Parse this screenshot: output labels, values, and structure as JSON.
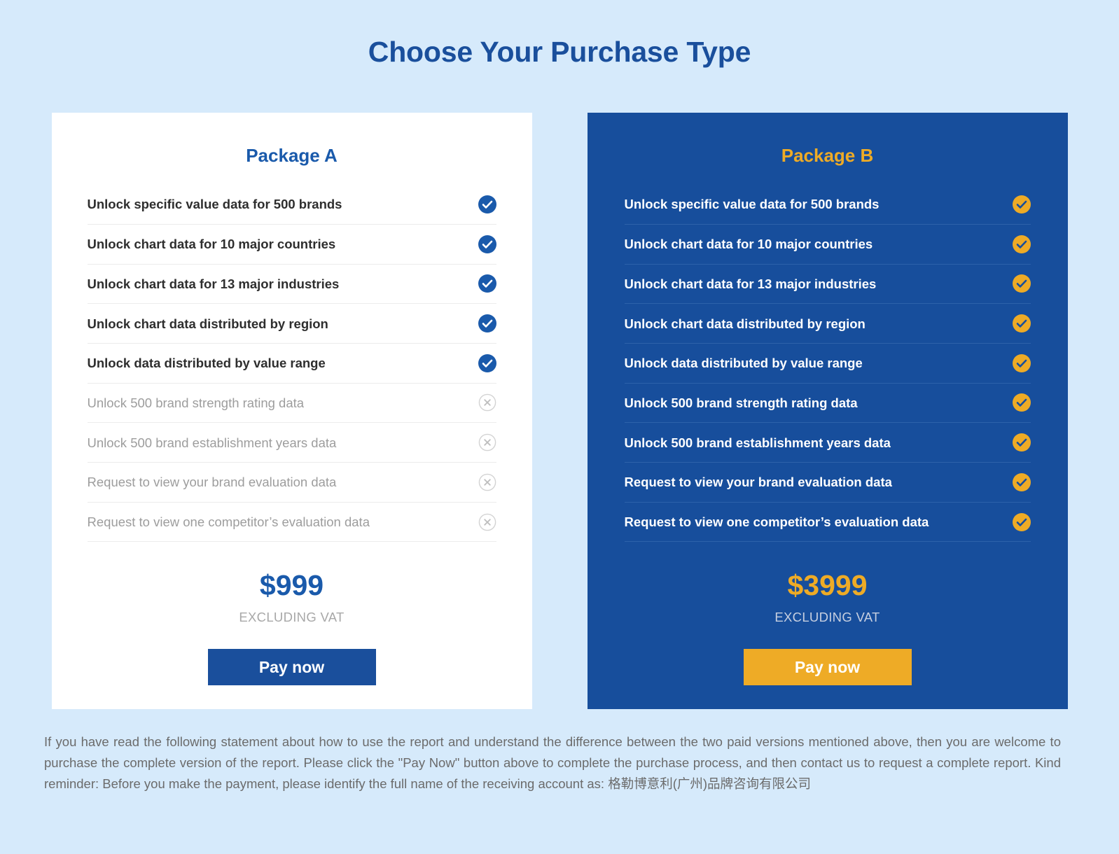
{
  "header": {
    "title": "Choose Your Purchase Type"
  },
  "colors": {
    "page_background": "#d6eafb",
    "brand_blue": "#1a4f9c",
    "card_b_background": "#174e9c",
    "accent_amber": "#eeab26",
    "disabled_gray": "#9d9d9d"
  },
  "packages": [
    {
      "name": "Package A",
      "price": "$999",
      "vat_note": "EXCLUDING VAT",
      "pay_label": "Pay now",
      "features": [
        {
          "label": "Unlock specific value data for 500 brands",
          "included": true,
          "icon": "check-circle-icon"
        },
        {
          "label": "Unlock chart data for 10 major countries",
          "included": true,
          "icon": "check-circle-icon"
        },
        {
          "label": "Unlock chart data for 13 major industries",
          "included": true,
          "icon": "check-circle-icon"
        },
        {
          "label": "Unlock chart data distributed by region",
          "included": true,
          "icon": "check-circle-icon"
        },
        {
          "label": "Unlock data distributed by value range",
          "included": true,
          "icon": "check-circle-icon"
        },
        {
          "label": "Unlock 500 brand strength rating data",
          "included": false,
          "icon": "x-circle-icon"
        },
        {
          "label": "Unlock 500 brand establishment years data",
          "included": false,
          "icon": "x-circle-icon"
        },
        {
          "label": "Request to view your brand evaluation data",
          "included": false,
          "icon": "x-circle-icon"
        },
        {
          "label": "Request to view one competitor’s evaluation data",
          "included": false,
          "icon": "x-circle-icon"
        }
      ]
    },
    {
      "name": "Package B",
      "price": "$3999",
      "vat_note": "EXCLUDING VAT",
      "pay_label": "Pay now",
      "features": [
        {
          "label": "Unlock specific value data for 500 brands",
          "included": true,
          "icon": "check-circle-icon"
        },
        {
          "label": "Unlock chart data for 10 major countries",
          "included": true,
          "icon": "check-circle-icon"
        },
        {
          "label": "Unlock chart data for 13 major industries",
          "included": true,
          "icon": "check-circle-icon"
        },
        {
          "label": "Unlock chart data distributed by region",
          "included": true,
          "icon": "check-circle-icon"
        },
        {
          "label": "Unlock data distributed by value range",
          "included": true,
          "icon": "check-circle-icon"
        },
        {
          "label": "Unlock 500 brand strength rating data",
          "included": true,
          "icon": "check-circle-icon"
        },
        {
          "label": "Unlock 500 brand establishment years data",
          "included": true,
          "icon": "check-circle-icon"
        },
        {
          "label": "Request to view your brand evaluation data",
          "included": true,
          "icon": "check-circle-icon"
        },
        {
          "label": "Request to view one competitor’s evaluation data",
          "included": true,
          "icon": "check-circle-icon"
        }
      ]
    }
  ],
  "footer": {
    "disclaimer": "If you have read the following statement about how to use the report and understand the difference between the two paid versions mentioned above, then you are welcome to purchase the complete version of the report. Please click the \"Pay Now\" button above to complete the purchase process, and then contact us to request a complete report. Kind reminder: Before you make the payment, please identify the full name of the receiving account as: 格勒博意利(广州)品牌咨询有限公司"
  }
}
